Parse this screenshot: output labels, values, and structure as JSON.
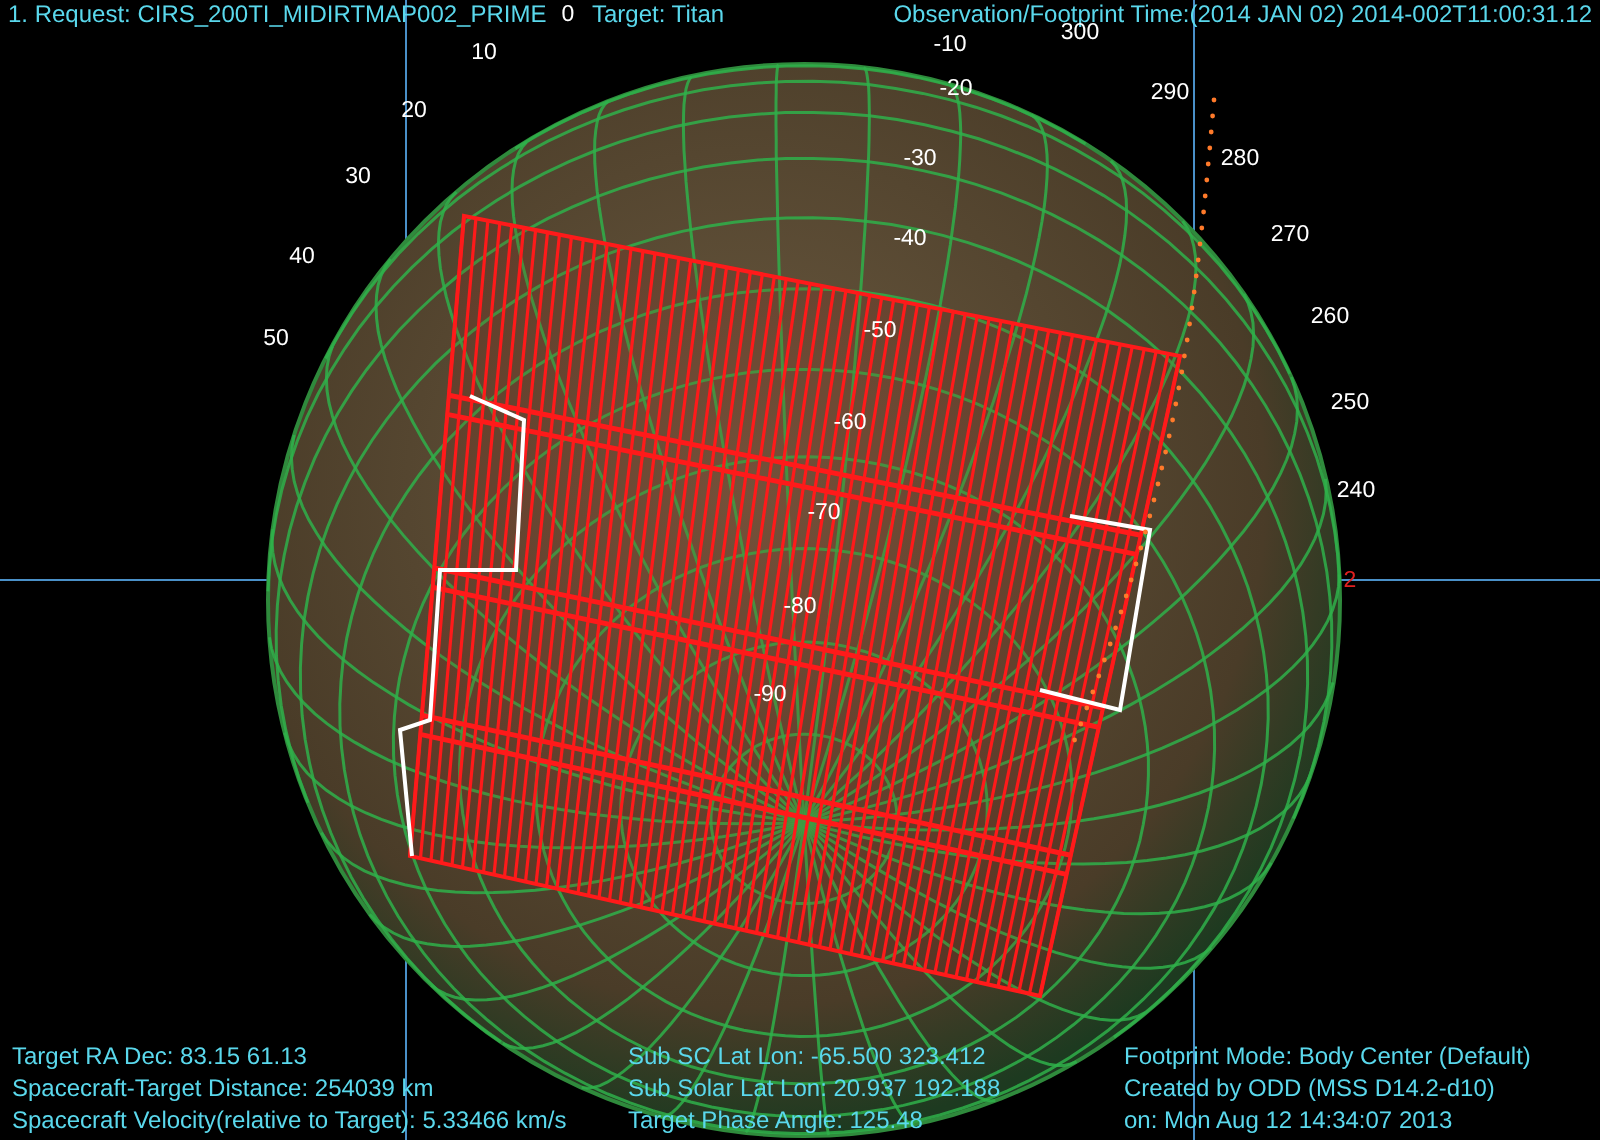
{
  "header": {
    "request": "1. Request: CIRS_200TI_MIDIRTMAP002_PRIME",
    "target": "Target: Titan",
    "observation_time": "Observation/Footprint Time:(2014 JAN 02) 2014-002T11:00:31.12"
  },
  "grid_labels": [
    {
      "text": "0"
    },
    {
      "text": "10"
    },
    {
      "text": "20"
    },
    {
      "text": "30"
    },
    {
      "text": "40"
    },
    {
      "text": "50"
    },
    {
      "text": "-10"
    },
    {
      "text": "-20"
    },
    {
      "text": "-30"
    },
    {
      "text": "-40"
    },
    {
      "text": "-50"
    },
    {
      "text": "-60"
    },
    {
      "text": "-70"
    },
    {
      "text": "-80"
    },
    {
      "text": "-90"
    },
    {
      "text": "300"
    },
    {
      "text": "290"
    },
    {
      "text": "280"
    },
    {
      "text": "270"
    },
    {
      "text": "260"
    },
    {
      "text": "250"
    },
    {
      "text": "240"
    }
  ],
  "marker": {
    "text": "2"
  },
  "info_columns": [
    [
      "Target RA Dec: 83.15  61.13",
      "Spacecraft-Target Distance:  254039 km",
      "Spacecraft Velocity(relative to Target): 5.33466 km/s"
    ],
    [
      "Sub SC Lat Lon: -65.500  323.412",
      "Sub Solar Lat Lon: 20.937  192.188",
      "Target Phase Angle: 125.48"
    ],
    [
      "Footprint Mode: Body Center (Default)",
      "Created by ODD (MSS D14.2-d10)",
      "on: Mon Aug 12 14:34:07 2013"
    ]
  ]
}
